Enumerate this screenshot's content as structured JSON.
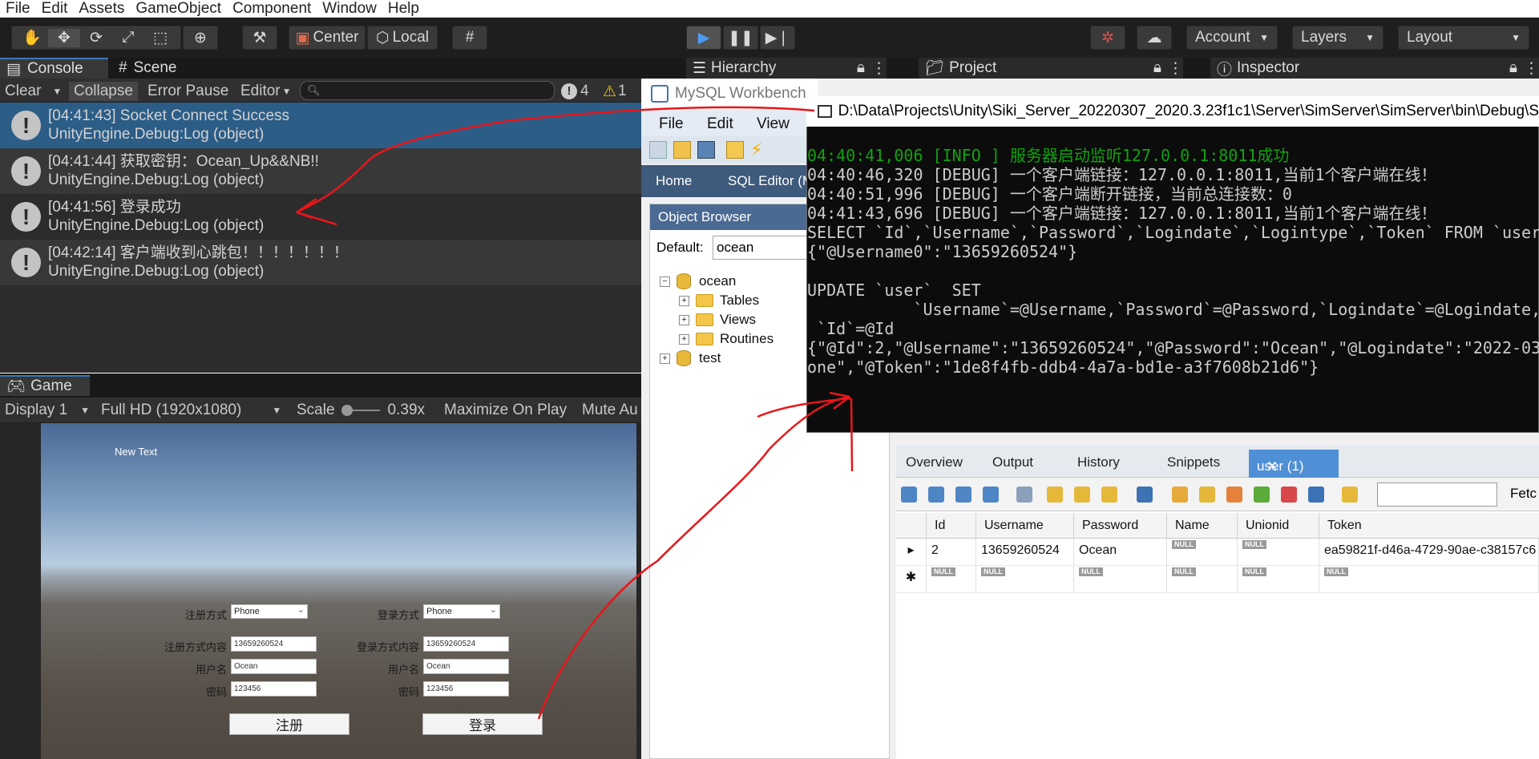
{
  "menubar": {
    "items": [
      "File",
      "Edit",
      "Assets",
      "GameObject",
      "Component",
      "Window",
      "Help"
    ]
  },
  "toolbar": {
    "center_label": "Center",
    "local_label": "Local",
    "account_label": "Account",
    "layers_label": "Layers",
    "layout_label": "Layout"
  },
  "console": {
    "tab_console": "Console",
    "tab_scene": "Scene",
    "clear": "Clear",
    "collapse": "Collapse",
    "error_pause": "Error Pause",
    "editor": "Editor",
    "count_info": "4",
    "count_warn": "1",
    "logs": [
      {
        "line1": "[04:41:43] Socket Connect Success",
        "line2": "UnityEngine.Debug:Log (object)"
      },
      {
        "line1": "[04:41:44] 获取密钥：Ocean_Up&&NB!!",
        "line2": "UnityEngine.Debug:Log (object)"
      },
      {
        "line1": "[04:41:56] 登录成功",
        "line2": "UnityEngine.Debug:Log (object)"
      },
      {
        "line1": "[04:42:14] 客户端收到心跳包！！！！！！！",
        "line2": "UnityEngine.Debug:Log (object)"
      }
    ]
  },
  "game": {
    "tab": "Game",
    "display": "Display 1",
    "resolution": "Full HD (1920x1080)",
    "scale_label": "Scale",
    "scale_value": "0.39x",
    "maximize": "Maximize On Play",
    "mute": "Mute Au",
    "new_text": "New Text",
    "reg_method_label": "注册方式",
    "reg_method_value": "Phone",
    "login_method_label": "登录方式",
    "login_method_value": "Phone",
    "reg_content_label": "注册方式内容",
    "reg_content_value": "13659260524",
    "login_content_label": "登录方式内容",
    "login_content_value": "13659260524",
    "reg_user_label": "用户名",
    "reg_user_value": "Ocean",
    "login_user_label": "用户名",
    "login_user_value": "Ocean",
    "reg_pwd_label": "密码",
    "reg_pwd_value": "123456",
    "login_pwd_label": "密码",
    "login_pwd_value": "123456",
    "register_btn": "注册",
    "login_btn": "登录"
  },
  "right_tabs": {
    "hierarchy": "Hierarchy",
    "project": "Project",
    "inspector": "Inspector"
  },
  "workbench": {
    "title": "MySQL Workbench",
    "menu": [
      "File",
      "Edit",
      "View"
    ],
    "home": "Home",
    "sql_editor": "SQL Editor (M",
    "object_browser": "Object Browser",
    "default_label": "Default:",
    "default_value": "ocean",
    "tree": {
      "ocean": "ocean",
      "tables": "Tables",
      "views": "Views",
      "routines": "Routines",
      "test": "test"
    },
    "lower_tabs": [
      "Overview",
      "Output",
      "History",
      "Snippets"
    ],
    "active_tab": "user (1)",
    "fetch": "Fetc",
    "columns": [
      "Id",
      "Username",
      "Password",
      "Name",
      "Unionid",
      "Token"
    ],
    "row": {
      "id": "2",
      "username": "13659260524",
      "password": "Ocean",
      "name": "NULL",
      "unionid": "NULL",
      "token": "ea59821f-d46a-4729-90ae-c38157c6"
    },
    "null_label": "NULL"
  },
  "cmd": {
    "title": "D:\\Data\\Projects\\Unity\\Siki_Server_20220307_2020.3.23f1c1\\Server\\SimServer\\SimServer\\bin\\Debug\\S",
    "lines": [
      "04:40:41,006 [INFO ] 服务器启动监听127.0.0.1:8011成功",
      "04:40:46,320 [DEBUG] 一个客户端链接：127.0.0.1:8011,当前1个客户端在线！",
      "04:40:51,996 [DEBUG] 一个客户端断开链接，当前总连接数：0",
      "04:41:43,696 [DEBUG] 一个客户端链接：127.0.0.1:8011,当前1个客户端在线！",
      "SELECT `Id`,`Username`,`Password`,`Logindate`,`Logintype`,`Token` FROM `user",
      "{\"@Username0\":\"13659260524\"}",
      "",
      "UPDATE `user`  SET",
      "           `Username`=@Username,`Password`=@Password,`Logindate`=@Logindate,",
      " `Id`=@Id",
      "{\"@Id\":2,\"@Username\":\"13659260524\",\"@Password\":\"Ocean\",\"@Logindate\":\"2022-03",
      "one\",\"@Token\":\"1de8f4fb-ddb4-4a7a-bd1e-a3f7608b21d6\"}"
    ]
  }
}
